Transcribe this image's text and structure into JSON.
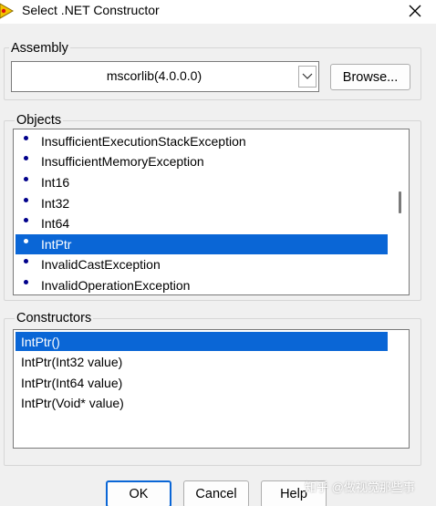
{
  "window": {
    "title": "Select .NET Constructor",
    "close_icon": "close-icon"
  },
  "assembly": {
    "label": "Assembly",
    "selected": "mscorlib(4.0.0.0)",
    "browse_label": "Browse..."
  },
  "objects": {
    "label": "Objects",
    "items": [
      "InsufficientExecutionStackException",
      "InsufficientMemoryException",
      "Int16",
      "Int32",
      "Int64",
      "IntPtr",
      "InvalidCastException",
      "InvalidOperationException"
    ],
    "selected_item": "IntPtr"
  },
  "constructors": {
    "label": "Constructors",
    "items": [
      "IntPtr()",
      "IntPtr(Int32 value)",
      "IntPtr(Int64 value)",
      "IntPtr(Void* value)"
    ],
    "selected_item": "IntPtr()"
  },
  "footer": {
    "ok_label": "OK",
    "cancel_label": "Cancel",
    "help_label": "Help"
  },
  "watermark": "知乎 @做视觉那些事",
  "colors": {
    "selection": "#0a66d6",
    "bullet": "#00008b",
    "dialog_bg": "#f0f0f0"
  }
}
